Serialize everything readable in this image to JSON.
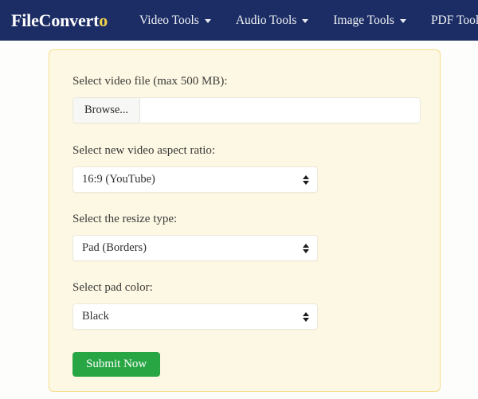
{
  "navbar": {
    "brand_main": "FileConvert",
    "brand_accent": "o",
    "items": [
      {
        "label": "Video Tools",
        "icon": "chevron-down-icon"
      },
      {
        "label": "Audio Tools",
        "icon": "chevron-down-icon"
      },
      {
        "label": "Image Tools",
        "icon": "chevron-down-icon"
      },
      {
        "label": "PDF Tools",
        "icon": "chevron-down-icon"
      }
    ],
    "background_color": "#1b2d64",
    "text_color": "#f1f2f6",
    "accent_color": "#f2d149"
  },
  "form": {
    "file_field": {
      "label": "Select video file (max 500 MB):",
      "browse_label": "Browse...",
      "file_name": "",
      "placeholder": ""
    },
    "aspect_ratio": {
      "label": "Select new video aspect ratio:",
      "value": "16:9 (YouTube)"
    },
    "resize_type": {
      "label": "Select the resize type:",
      "value": "Pad (Borders)"
    },
    "pad_color": {
      "label": "Select pad color:",
      "value": "Black"
    },
    "submit_label": "Submit Now",
    "card_background": "#fdf8e3",
    "card_border": "#f5dd8a",
    "submit_color": "#28a644"
  }
}
